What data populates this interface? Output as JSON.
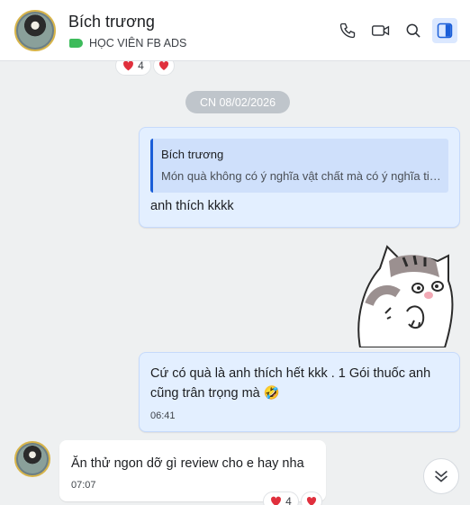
{
  "header": {
    "contact_name": "Bích trương",
    "label": "HỌC VIÊN FB ADS",
    "icons": [
      "phone-icon",
      "video-call-icon",
      "search-icon",
      "sidebar-toggle-icon"
    ]
  },
  "date_separator": "CN 08/02/2026",
  "top_reactions": {
    "count": "4"
  },
  "messages": [
    {
      "direction": "out",
      "quote": {
        "author": "Bích trương",
        "text": "Món quà không có ý nghĩa vật chất mà có ý nghĩa tinh thần"
      },
      "text": "anh thích kkkk"
    },
    {
      "direction": "out",
      "type": "sticker",
      "sticker": "cat-sticker"
    },
    {
      "direction": "out",
      "text_line1": "Cứ có quà là anh thích hết kkk . 1 Gói thuốc anh",
      "text_line2": "cũng trân trọng mà 🤣",
      "time": "06:41"
    },
    {
      "direction": "in",
      "text": "Ăn thử ngon dỡ gì  review cho e hay nha",
      "time": "07:07",
      "reaction_count": "4"
    }
  ],
  "colors": {
    "accent": "#1a5ed8",
    "outgoing_bubble": "#e3efff",
    "tag": "#3dbb5b",
    "heart": "#e0303d"
  }
}
